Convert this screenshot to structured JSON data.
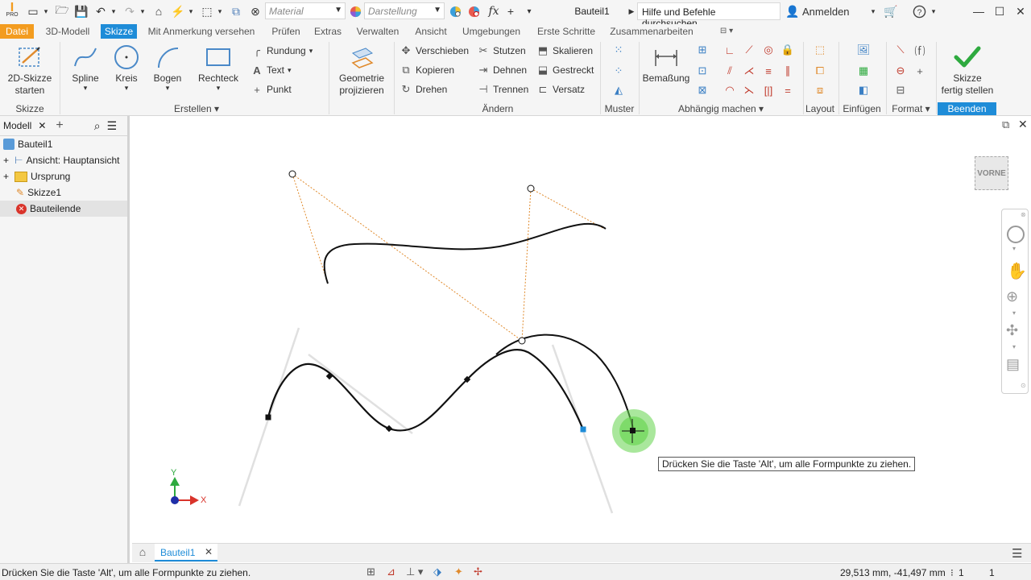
{
  "titlebar": {
    "material_placeholder": "Material",
    "appearance_placeholder": "Darstellung",
    "doc_title": "Bauteil1",
    "search_placeholder": "Hilfe und Befehle durchsuchen...",
    "sign_in": "Anmelden",
    "logo_text": "PRO"
  },
  "menu_tabs": [
    {
      "label": "Datei"
    },
    {
      "label": "3D-Modell"
    },
    {
      "label": "Skizze"
    },
    {
      "label": "Mit Anmerkung versehen"
    },
    {
      "label": "Prüfen"
    },
    {
      "label": "Extras"
    },
    {
      "label": "Verwalten"
    },
    {
      "label": "Ansicht"
    },
    {
      "label": "Umgebungen"
    },
    {
      "label": "Erste Schritte"
    },
    {
      "label": "Zusammenarbeiten"
    }
  ],
  "ribbon": {
    "skizze": {
      "btn_line1": "2D-Skizze",
      "btn_line2": "starten",
      "group": "Skizze"
    },
    "erstellen": {
      "spline": "Spline",
      "kreis": "Kreis",
      "bogen": "Bogen",
      "rechteck": "Rechteck",
      "rundung": "Rundung",
      "text": "Text",
      "punkt": "Punkt",
      "group": "Erstellen"
    },
    "projizieren": {
      "line1": "Geometrie",
      "line2": "projizieren"
    },
    "aendern": {
      "verschieben": "Verschieben",
      "kopieren": "Kopieren",
      "drehen": "Drehen",
      "stutzen": "Stutzen",
      "dehnen": "Dehnen",
      "trennen": "Trennen",
      "skalieren": "Skalieren",
      "gestreckt": "Gestreckt",
      "versatz": "Versatz",
      "group": "Ändern"
    },
    "muster": {
      "group": "Muster"
    },
    "abhaengig": {
      "bemassung": "Bemaßung",
      "group": "Abhängig machen"
    },
    "layout": {
      "group": "Layout"
    },
    "einfuegen": {
      "group": "Einfügen"
    },
    "format": {
      "group": "Format"
    },
    "beenden": {
      "line1": "Skizze",
      "line2": "fertig stellen",
      "group": "Beenden"
    }
  },
  "browser": {
    "tab_label": "Modell",
    "items": [
      {
        "label": "Bauteil1"
      },
      {
        "label": "Ansicht: Hauptansicht"
      },
      {
        "label": "Ursprung"
      },
      {
        "label": "Skizze1"
      },
      {
        "label": "Bauteilende"
      }
    ]
  },
  "canvas": {
    "viewcube_label": "VORNE",
    "tooltip": "Drücken Sie die Taste 'Alt', um alle Formpunkte zu ziehen.",
    "axis_x": "X",
    "axis_y": "Y"
  },
  "doc_tabs": [
    {
      "label": "Bauteil1"
    }
  ],
  "status": {
    "message": "Drücken Sie die Taste 'Alt', um alle Formpunkte zu ziehen.",
    "coordinates": "29,513 mm, -41,497 mm",
    "count1": "1",
    "count2": "1"
  },
  "colors": {
    "accent": "#1e8cd8",
    "file_tab": "#f39c1f",
    "finish_check": "#2eaa3f",
    "spline": "#111111",
    "handle_line": "#e08a2c",
    "active_point": "#63d34a"
  }
}
